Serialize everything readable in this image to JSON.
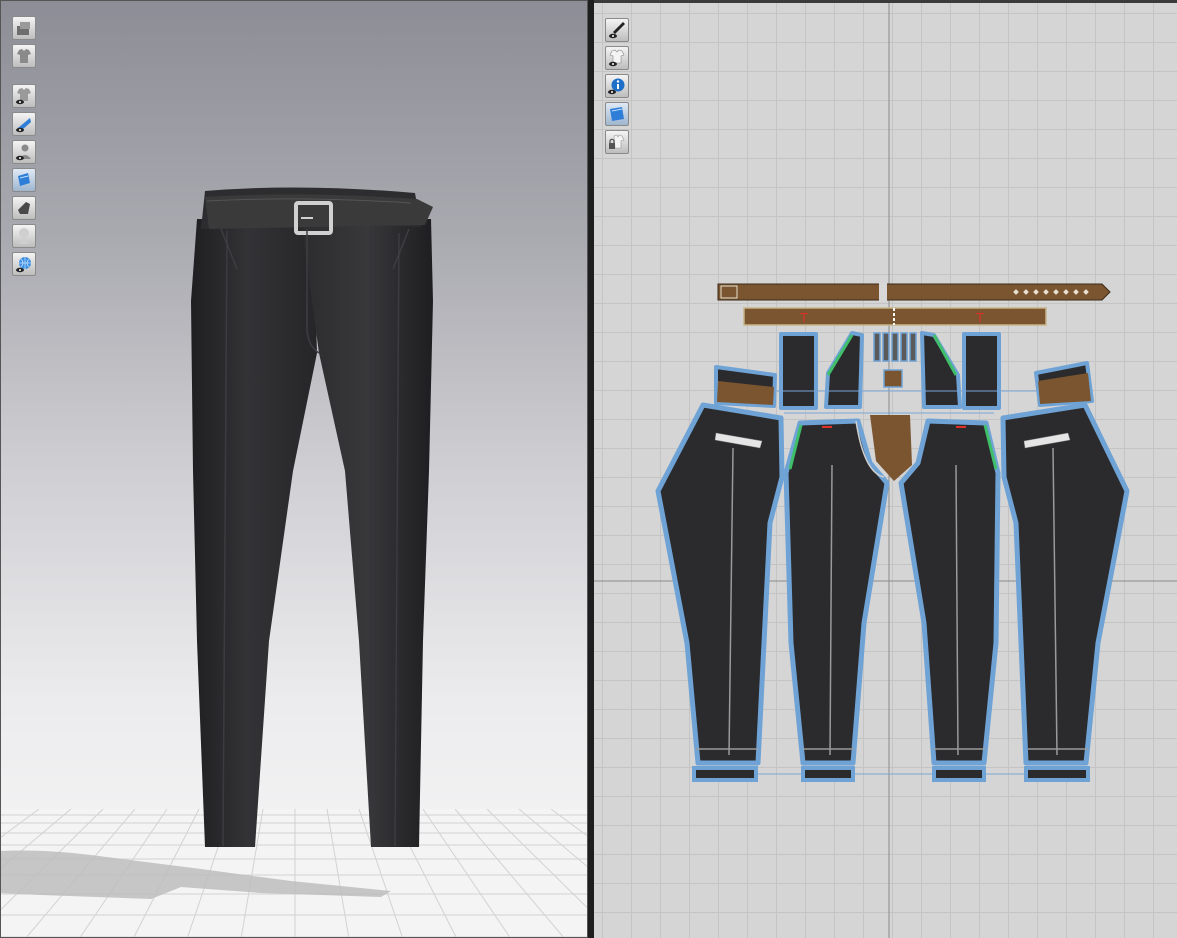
{
  "viewport_3d": {
    "toolbar": [
      {
        "id": "avatar-display-icon"
      },
      {
        "id": "garment-display-icon"
      },
      {
        "id": "show-garment-icon"
      },
      {
        "id": "texture-display-icon"
      },
      {
        "id": "show-avatar-icon"
      },
      {
        "id": "fabric-display-icon"
      },
      {
        "id": "pressure-map-icon"
      },
      {
        "id": "avatar-silhouette-icon"
      },
      {
        "id": "globe-view-icon"
      }
    ],
    "garment_color": "#2a2a2c",
    "belt_color": "#3a3a3a",
    "buckle_color": "#d0d0d0"
  },
  "pattern_2d": {
    "toolbar": [
      {
        "id": "show-measure-icon"
      },
      {
        "id": "show-pattern-icon"
      },
      {
        "id": "info-icon"
      },
      {
        "id": "fabric-view-icon"
      },
      {
        "id": "lock-pattern-icon"
      }
    ],
    "colors": {
      "panel_fill": "#2b2b2d",
      "panel_outline": "#6fa3d6",
      "leather": "#7a5530",
      "seam_green": "#3fbf6a",
      "notch_red": "#e0302a",
      "grid_bg": "#d5d5d5"
    },
    "markers": [
      "T",
      "T"
    ]
  }
}
